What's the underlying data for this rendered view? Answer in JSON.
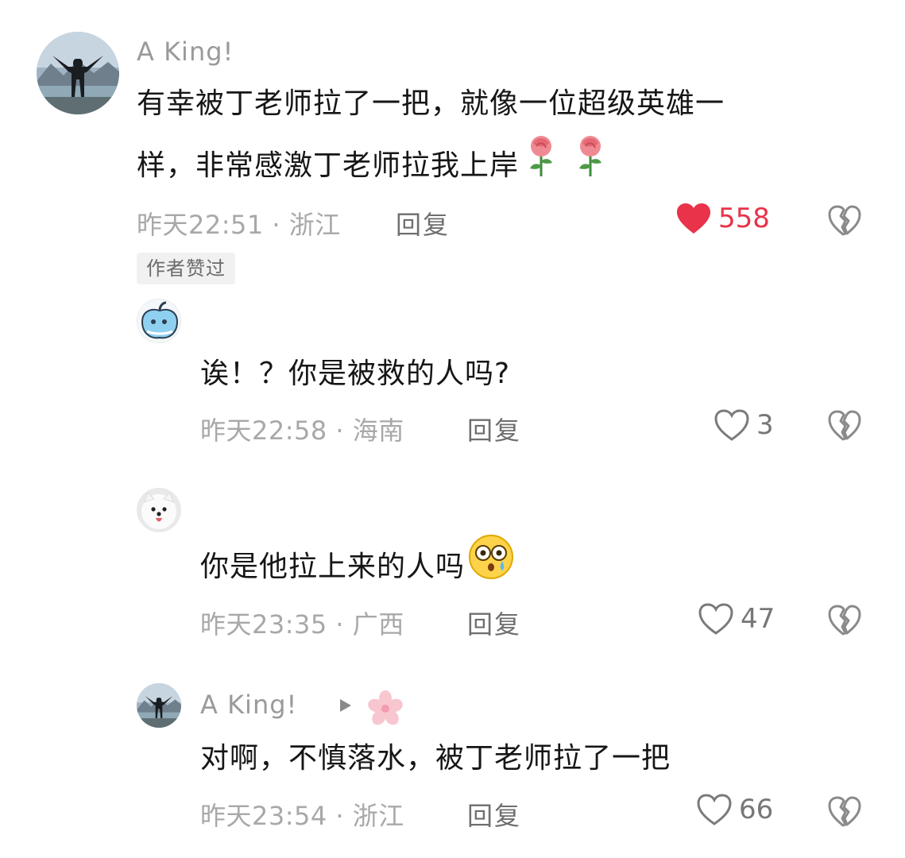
{
  "comments": [
    {
      "username": "A  King!",
      "text_line1": "有幸被丁老师拉了一把，就像一位超级英雄一",
      "text_line2": "样，非常感激丁老师拉我上岸",
      "time_location": "昨天22:51 · 浙江",
      "reply_label": "回复",
      "likes": "558",
      "liked": true,
      "badge": "作者赞过"
    },
    {
      "username": "",
      "text": "诶！？你是被救的人吗?",
      "time_location": "昨天22:58 · 海南",
      "reply_label": "回复",
      "likes": "3"
    },
    {
      "username": "",
      "text": "你是他拉上来的人吗",
      "time_location": "昨天23:35 · 广西",
      "reply_label": "回复",
      "likes": "47"
    },
    {
      "username": "A  King!",
      "text": "对啊，不慎落水，被丁老师拉了一把",
      "time_location": "昨天23:54 · 浙江",
      "reply_label": "回复",
      "likes": "66"
    }
  ],
  "colors": {
    "like_active": "#e8334a",
    "meta": "#a8a8a8"
  },
  "icons": [
    "rose-emoji-icon",
    "astonished-emoji-icon",
    "heart-icon",
    "broken-heart-icon",
    "play-icon",
    "flower-icon"
  ]
}
